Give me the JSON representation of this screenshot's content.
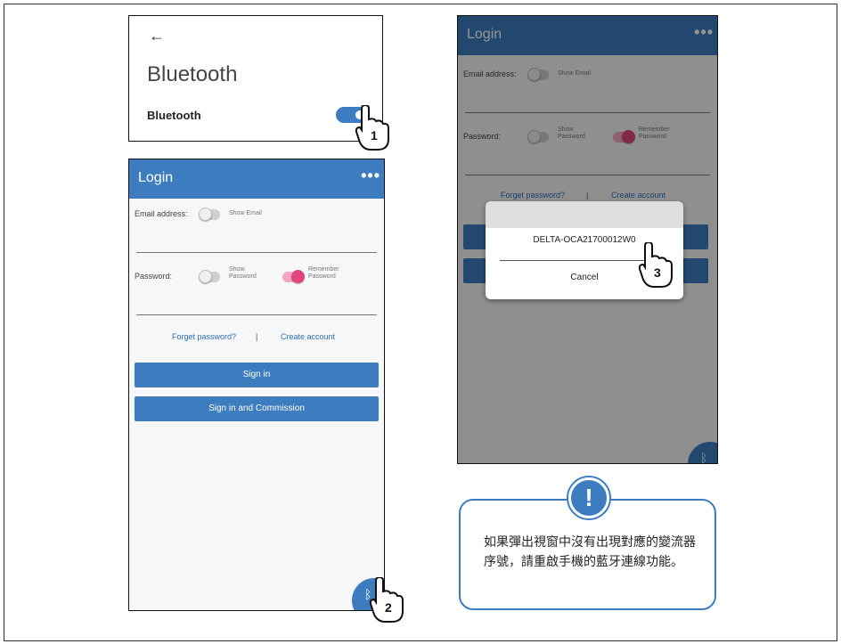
{
  "bluetooth_settings": {
    "back_arrow": "←",
    "title": "Bluetooth",
    "row_label": "Bluetooth",
    "toggle_state": "on"
  },
  "login": {
    "title": "Login",
    "menu_icon": "•••",
    "email_label": "Email address:",
    "show_email": "Show Email",
    "password_label": "Password:",
    "show_password_1": "Show",
    "show_password_2": "Password",
    "remember_1": "Remember",
    "remember_2": "Password",
    "forget_password": "Forget password?",
    "separator": "|",
    "create_account": "Create account",
    "sign_in": "Sign in",
    "sign_in_commission": "Sign in and Commission",
    "bluetooth_fab_icon": "bluetooth-icon"
  },
  "popup": {
    "device": "DELTA-OCA21700012W0",
    "cancel": "Cancel"
  },
  "steps": [
    "1",
    "2",
    "3"
  ],
  "notice": {
    "icon": "!",
    "text": "如果彈出視窗中沒有出現對應的變流器序號，請重啟手機的藍牙連線功能。"
  },
  "colors": {
    "appbar": "#3d7dbf",
    "accent_toggle": "#e2457d",
    "button": "#3d7dbf"
  }
}
